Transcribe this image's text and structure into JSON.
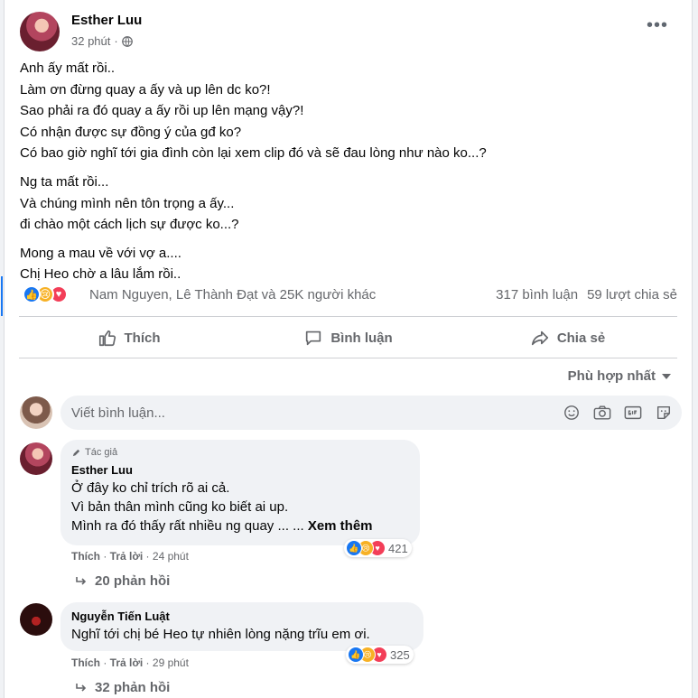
{
  "post": {
    "author": "Esther Luu",
    "time": "32 phút",
    "more_icon": "more-horizontal-icon",
    "paragraphs": [
      [
        "Anh ấy mất rồi..",
        "Làm ơn đừng quay a ấy và up lên dc ko?!",
        "Sao phải ra đó quay a ấy rồi up lên mạng vậy?!",
        "Có nhận được sự đồng ý của gđ ko?",
        "Có bao giờ nghĩ tới gia đình còn lại xem clip đó và sẽ đau lòng như nào ko...?"
      ],
      [
        "Ng ta mất rồi...",
        "Và chúng mình nên tôn trọng a ấy...",
        "đi chào một cách lịch sự được ko...?"
      ],
      [
        "Mong a mau về với vợ a....",
        "Chị Heo chờ a lâu lắm rồi.."
      ]
    ]
  },
  "stats": {
    "reactors": "Nam Nguyen, Lê Thành Đạt và 25K người khác",
    "comments": "317 bình luận",
    "shares": "59 lượt chia sẻ"
  },
  "actions": {
    "like": "Thích",
    "comment": "Bình luận",
    "share": "Chia sẻ"
  },
  "sort_label": "Phù hợp nhất",
  "composer": {
    "placeholder": "Viết bình luận..."
  },
  "comments": [
    {
      "author_tag": "Tác giả",
      "name": "Esther Luu",
      "lines": [
        "Ở đây ko chỉ trích rõ ai cả.",
        "Vì bản thân mình cũng ko biết ai up.",
        "Mình ra đó thấy rất nhiều ng quay ... ..."
      ],
      "see_more": "Xem thêm",
      "like": "Thích",
      "reply": "Trả lời",
      "time": "24 phút",
      "reaction_count": "421",
      "replies": "20 phản hồi"
    },
    {
      "name": "Nguyễn Tiến Luật",
      "lines": [
        "Nghĩ tới chị bé Heo tự nhiên lòng nặng trĩu em ơi."
      ],
      "like": "Thích",
      "reply": "Trả lời",
      "time": "29 phút",
      "reaction_count": "325",
      "replies": "32 phản hồi"
    }
  ],
  "colors": {
    "accent": "#1877f2",
    "text_secondary": "#65676b",
    "sad": "#f7b125",
    "love": "#f33e58"
  }
}
